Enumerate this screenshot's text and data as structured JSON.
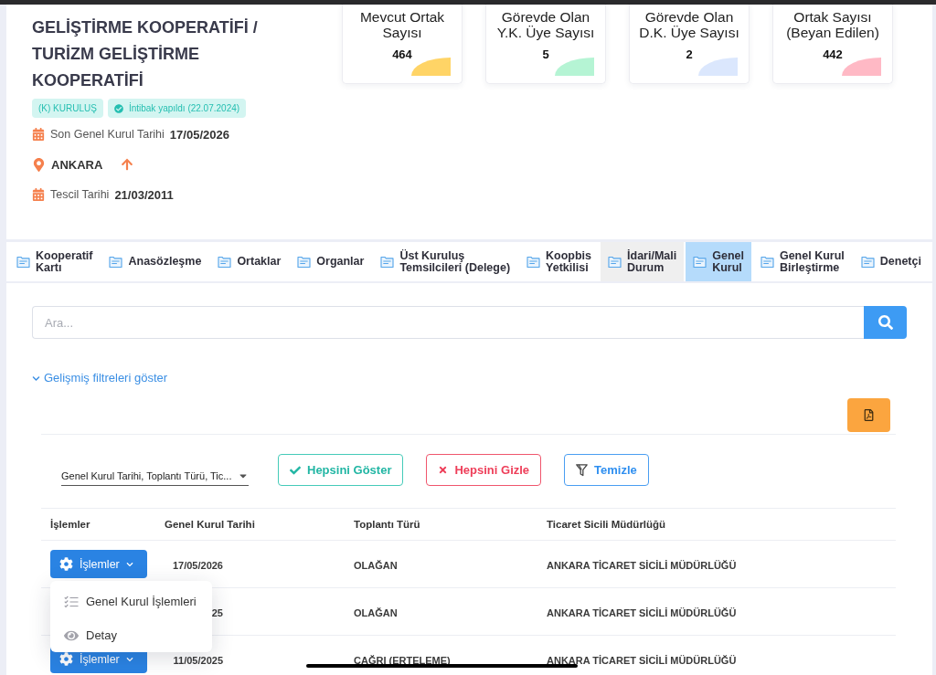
{
  "cooperative": {
    "title": "GELİŞTİRME KOOPERATİFİ /\nTURİZM GELİŞTİRME\nKOOPERATİFİ",
    "badges": [
      {
        "kind": "plain",
        "label": "(K) KURULUŞ"
      },
      {
        "kind": "verified",
        "label": "İntibak yapıldı (22.07.2024)"
      }
    ],
    "facts": [
      {
        "kind": "date",
        "label": "Son Genel Kurul Tarihi",
        "value": "17/05/2026"
      },
      {
        "kind": "location",
        "value": "ANKARA"
      },
      {
        "kind": "date",
        "label": "Tescil Tarihi",
        "value": "21/03/2011"
      }
    ]
  },
  "stats": [
    {
      "label": "Mevcut Ortak\nSayısı",
      "value": "464",
      "color": "#ffd466"
    },
    {
      "label": "Görevde Olan\nY.K. Üye Sayısı",
      "value": "5",
      "color": "#b5f4d4"
    },
    {
      "label": "Görevde Olan\nD.K. Üye Sayısı",
      "value": "2",
      "color": "#dbe7fd"
    },
    {
      "label": "Ortak Sayısı\n(Beyan Edilen)",
      "value": "442",
      "color": "#ffb9c5"
    }
  ],
  "tabs": [
    {
      "label": "Kooperatif\nKartı",
      "selected": false,
      "hovered": false
    },
    {
      "label": "Anasözleşme",
      "selected": false,
      "hovered": false
    },
    {
      "label": "Ortaklar",
      "selected": false,
      "hovered": false
    },
    {
      "label": "Organlar",
      "selected": false,
      "hovered": false
    },
    {
      "label": "Üst Kuruluş\nTemsilcileri (Delege)",
      "selected": false,
      "hovered": false
    },
    {
      "label": "Koopbis\nYetkilisi",
      "selected": false,
      "hovered": false
    },
    {
      "label": "İdari/Mali\nDurum",
      "selected": false,
      "hovered": true
    },
    {
      "label": "Genel\nKurul",
      "selected": true,
      "hovered": false
    },
    {
      "label": "Genel Kurul\nBirleştirme",
      "selected": false,
      "hovered": false
    },
    {
      "label": "Denetçi",
      "selected": false,
      "hovered": false
    }
  ],
  "search": {
    "placeholder": "Ara..."
  },
  "advanced_filters_link": "Gelişmiş filtreleri göster",
  "column_picker": {
    "value": "Genel Kurul Tarihi, Toplantı Türü, Tic..."
  },
  "filter_buttons": [
    {
      "kind": "show",
      "label": "Hepsini Göster"
    },
    {
      "kind": "hide",
      "label": "Hepsini Gizle"
    },
    {
      "kind": "clear",
      "label": "Temizle"
    }
  ],
  "table": {
    "columns": [
      "İşlemler",
      "Genel Kurul Tarihi",
      "Toplantı Türü",
      "Ticaret Sicili Müdürlüğü"
    ],
    "rows": [
      {
        "actions": "İşlemler",
        "date": "17/05/2026",
        "meeting_type": "OLAĞAN",
        "registry": "ANKARA TİCARET SİCİLİ MÜDÜRLÜĞÜ"
      },
      {
        "date": "25",
        "meeting_type": "OLAĞAN",
        "registry": "ANKARA TİCARET SİCİLİ MÜDÜRLÜĞÜ"
      },
      {
        "actions": "İşlemler",
        "date": "11/05/2025",
        "meeting_type": "ÇAĞRI (ERTELEME)",
        "registry": "ANKARA TİCARET SİCİLİ MÜDÜRLÜĞÜ"
      }
    ]
  },
  "actions_menu": {
    "open": true,
    "items": [
      {
        "kind": "list",
        "label": "Genel Kurul İşlemleri"
      },
      {
        "kind": "view",
        "label": "Detay"
      }
    ]
  }
}
